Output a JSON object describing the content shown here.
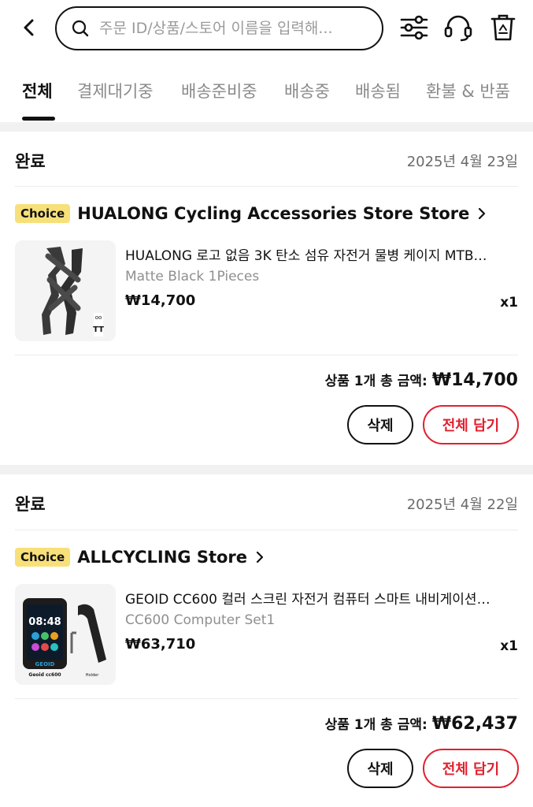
{
  "search": {
    "placeholder": "주문 ID/상품/스토어 이름을 입력해..."
  },
  "tabs": [
    {
      "label": "전체",
      "active": true
    },
    {
      "label": "결제대기중"
    },
    {
      "label": "배송준비중"
    },
    {
      "label": "배송중"
    },
    {
      "label": "배송됨"
    },
    {
      "label": "환불 & 반품"
    }
  ],
  "orders": [
    {
      "status": "완료",
      "date": "2025년 4월 23일",
      "badge": "Choice",
      "store": "HUALONG Cycling Accessories Store Store",
      "item": {
        "title": "HUALONG 로고 없음 3K 탄소 섬유 자전거 물병 케이지 MTB…",
        "variant": "Matte Black 1Pieces",
        "price": "₩14,700",
        "qty": "x1"
      },
      "total_label": "상품 1개 총 금액:",
      "total_amount": "₩14,700",
      "delete_label": "삭제",
      "cart_label": "전체 담기"
    },
    {
      "status": "완료",
      "date": "2025년 4월 22일",
      "badge": "Choice",
      "store": "ALLCYCLING Store",
      "item": {
        "title": "GEOID CC600 컬러 스크린 자전거 컴퓨터 스마트 내비게이션…",
        "variant": "CC600 Computer Set1",
        "price": "₩63,710",
        "qty": "x1",
        "thumb_time": "08:48",
        "thumb_brand": "GEOID",
        "thumb_caption": "Geoid cc600",
        "thumb_holder": "Holder"
      },
      "total_label": "상품 1개 총 금액:",
      "total_amount": "₩62,437",
      "delete_label": "삭제",
      "cart_label": "전체 담기"
    }
  ],
  "colors": {
    "accent_red": "#e0202e",
    "choice_yellow": "#f7e07a"
  }
}
